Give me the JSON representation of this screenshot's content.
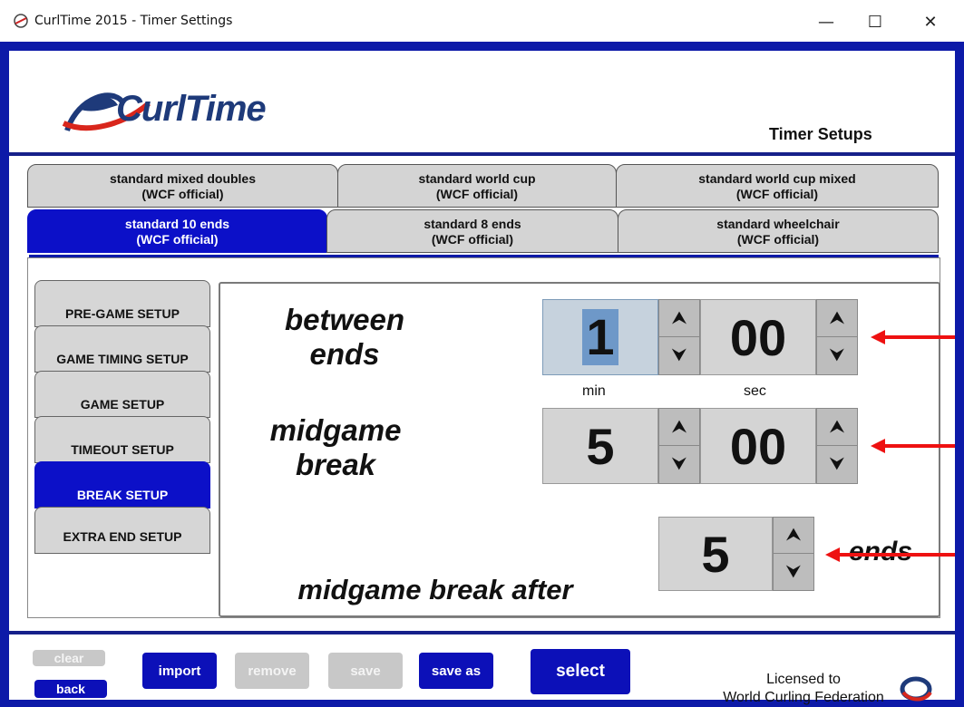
{
  "window": {
    "title": "CurlTime 2015 - Timer Settings",
    "minimize": "—",
    "maximize": "☐",
    "close": "✕"
  },
  "header": {
    "logo_text": "CurlTime",
    "title": "Timer Setups"
  },
  "tabs": [
    {
      "line1": "standard mixed doubles",
      "line2": "(WCF official)"
    },
    {
      "line1": "standard world cup",
      "line2": "(WCF official)"
    },
    {
      "line1": "standard world cup mixed",
      "line2": "(WCF official)"
    },
    {
      "line1": "standard 10 ends",
      "line2": "(WCF official)",
      "active": true
    },
    {
      "line1": "standard 8 ends",
      "line2": "(WCF official)"
    },
    {
      "line1": "standard wheelchair",
      "line2": "(WCF official)"
    }
  ],
  "side_nav": [
    {
      "label": "PRE-GAME SETUP"
    },
    {
      "label": "GAME TIMING SETUP"
    },
    {
      "label": "GAME SETUP"
    },
    {
      "label": "TIMEOUT SETUP"
    },
    {
      "label": "BREAK SETUP",
      "active": true
    },
    {
      "label": "EXTRA END SETUP"
    }
  ],
  "between_ends": {
    "label_line1": "between",
    "label_line2": "ends",
    "min": "1",
    "sec": "00"
  },
  "units": {
    "min": "min",
    "sec": "sec"
  },
  "midgame_break": {
    "label_line1": "midgame",
    "label_line2": "break",
    "min": "5",
    "sec": "00"
  },
  "midgame_after": {
    "label": "midgame break after",
    "value": "5",
    "unit": "ends"
  },
  "spinner": {
    "up": "⮝",
    "down": "⮟"
  },
  "buttons": {
    "clear": "clear",
    "back": "back",
    "import": "import",
    "remove": "remove",
    "save": "save",
    "save_as": "save as",
    "select": "select"
  },
  "license": {
    "line1": "Licensed to",
    "line2": "World Curling Federation"
  },
  "colors": {
    "frame_blue": "#0d1aa8",
    "active_blue": "#0c10c8",
    "arrow_red": "#ee1111"
  }
}
